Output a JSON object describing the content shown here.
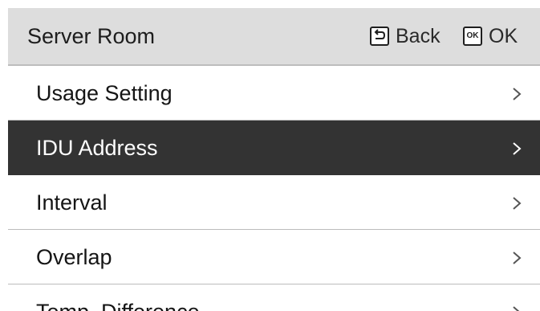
{
  "header": {
    "title": "Server Room",
    "back_label": "Back",
    "ok_label": "OK",
    "ok_icon_text": "OK"
  },
  "menu": {
    "items": [
      {
        "label": "Usage Setting",
        "selected": false
      },
      {
        "label": "IDU Address",
        "selected": true
      },
      {
        "label": "Interval",
        "selected": false
      },
      {
        "label": "Overlap",
        "selected": false
      },
      {
        "label": "Temp. Difference",
        "selected": false
      }
    ]
  },
  "colors": {
    "header_bg": "#dddddd",
    "selected_bg": "#333333",
    "text": "#151515",
    "selected_text": "#ffffff",
    "divider": "#bcbcbc"
  },
  "icons": {
    "back": "back-return-icon",
    "ok": "ok-icon",
    "row_arrow": "chevron-right-icon"
  }
}
